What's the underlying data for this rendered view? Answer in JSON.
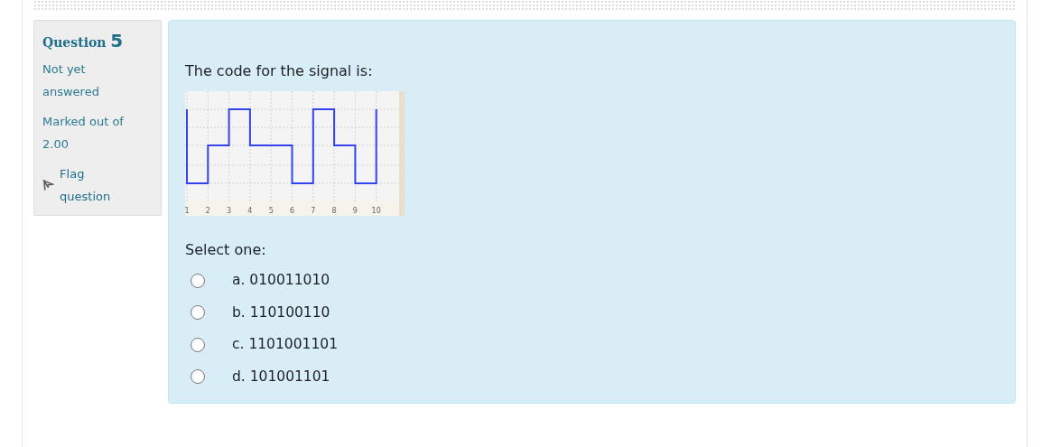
{
  "info": {
    "label": "Question",
    "number": "5",
    "state": "Not yet answered",
    "grade": "Marked out of 2.00",
    "flag": "Flag question"
  },
  "question": {
    "text": "The code for the signal is:",
    "signal_axis_labels": [
      "1",
      "2",
      "3",
      "4",
      "5",
      "6",
      "7",
      "8",
      "9",
      "10"
    ],
    "prompt": "Select one:",
    "options": [
      {
        "letter": "a.",
        "text": "010011010",
        "selected": false
      },
      {
        "letter": "b.",
        "text": "110100110",
        "selected": false
      },
      {
        "letter": "c.",
        "text": "1101001101",
        "selected": false
      },
      {
        "letter": "d.",
        "text": "101001101",
        "selected": false
      }
    ]
  }
}
